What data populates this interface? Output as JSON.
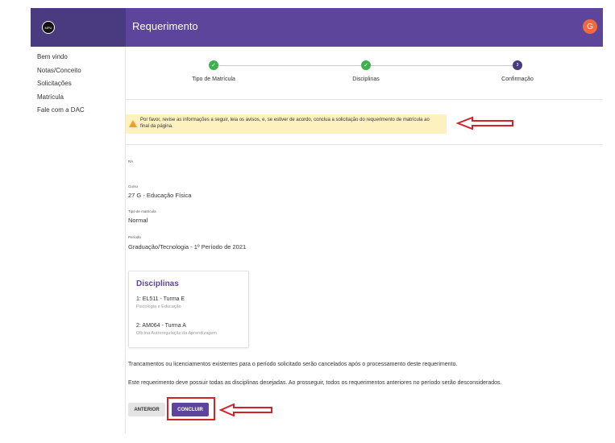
{
  "logo": {
    "text": "MPU"
  },
  "sidebar": {
    "items": [
      {
        "label": "Bem vindo"
      },
      {
        "label": "Notas/Conceito"
      },
      {
        "label": "Solicitações"
      },
      {
        "label": "Matrícula"
      },
      {
        "label": "Fale com a DAC"
      }
    ]
  },
  "header": {
    "title": "Requerimento",
    "avatar_letter": "G",
    "color": "#5c459a"
  },
  "stepper": {
    "steps": [
      {
        "label": "Tipo de Matrícula",
        "state": "done",
        "marker": "✓"
      },
      {
        "label": "Disciplinas",
        "state": "done",
        "marker": "✓"
      },
      {
        "label": "Confirmação",
        "state": "current",
        "marker": "3"
      }
    ]
  },
  "alert": {
    "text": "Por favor, revise as informações a seguir, leia os avisos, e, se estiver de acordo, conclua a solicitação do requerimento de matrícula ao final da página."
  },
  "fields": {
    "ra_label": "RA",
    "curso_label": "Curso",
    "curso_value": "27 G - Educação Física",
    "tipo_label": "Tipo de matrícula",
    "tipo_value": "Normal",
    "periodo_label": "Período",
    "periodo_value": "Graduação/Tecnologia - 1º Período de 2021"
  },
  "disciplinas": {
    "title": "Disciplinas",
    "items": [
      {
        "title": "1: EL511 - Turma E",
        "subtitle": "Psicologia e Educação"
      },
      {
        "title": "2: AM064 - Turma A",
        "subtitle": "Oficina Autorregulação da Aprendizagem"
      }
    ]
  },
  "notices": {
    "trancamentos": "Trancamentos ou licenciamentos existentes para o período solicitado serão cancelados após o processamento deste requerimento.",
    "requerimento": "Este requerimento deve possuir todas as disciplinas desejadas. Ao prosseguir, todos os requerimentos anteriores no período serão desconsiderados."
  },
  "buttons": {
    "previous": "ANTERIOR",
    "conclude": "CONCLUIR"
  }
}
